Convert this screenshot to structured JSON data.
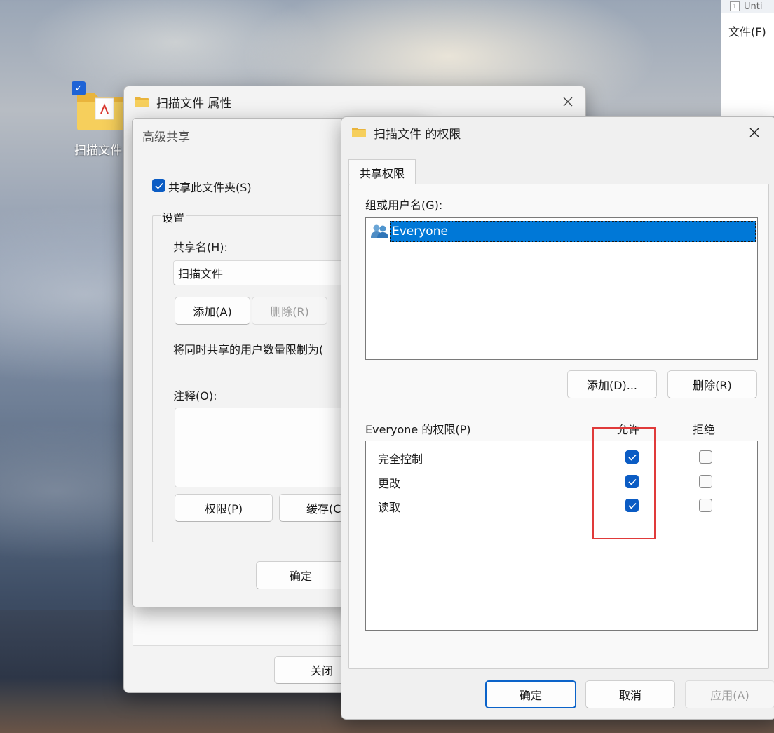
{
  "desktop": {
    "icon_label": "扫描文件",
    "icon_checked": true
  },
  "notepad": {
    "tab_number": "1",
    "tab_title": "Unti",
    "menu_file": "文件(F)"
  },
  "properties_window": {
    "title": "扫描文件 属性",
    "close_button": "关闭"
  },
  "advanced_share": {
    "title": "高级共享",
    "share_checkbox_label": "共享此文件夹(S)",
    "share_checked": true,
    "settings_group": "设置",
    "share_name_label": "共享名(H):",
    "share_name_value": "扫描文件",
    "add_button": "添加(A)",
    "remove_button": "删除(R)",
    "limit_label": "将同时共享的用户数量限制为(",
    "comment_label": "注释(O):",
    "permissions_button": "权限(P)",
    "cache_button": "缓存(C",
    "ok_button": "确定"
  },
  "permissions_dialog": {
    "title": "扫描文件 的权限",
    "tab_label": "共享权限",
    "group_label": "组或用户名(G):",
    "users": [
      {
        "name": "Everyone",
        "icon": "users-group-icon",
        "selected": true
      }
    ],
    "add_button": "添加(D)...",
    "remove_button": "删除(R)",
    "perm_header_label": "Everyone 的权限(P)",
    "col_allow": "允许",
    "col_deny": "拒绝",
    "permissions": [
      {
        "name": "完全控制",
        "allow": true,
        "deny": false
      },
      {
        "name": "更改",
        "allow": true,
        "deny": false
      },
      {
        "name": "读取",
        "allow": true,
        "deny": false
      }
    ],
    "ok_button": "确定",
    "cancel_button": "取消",
    "apply_button": "应用(A)",
    "highlight_color": "#e03a3a",
    "accent_color": "#0b5cc4",
    "selection_color": "#0078d7"
  }
}
